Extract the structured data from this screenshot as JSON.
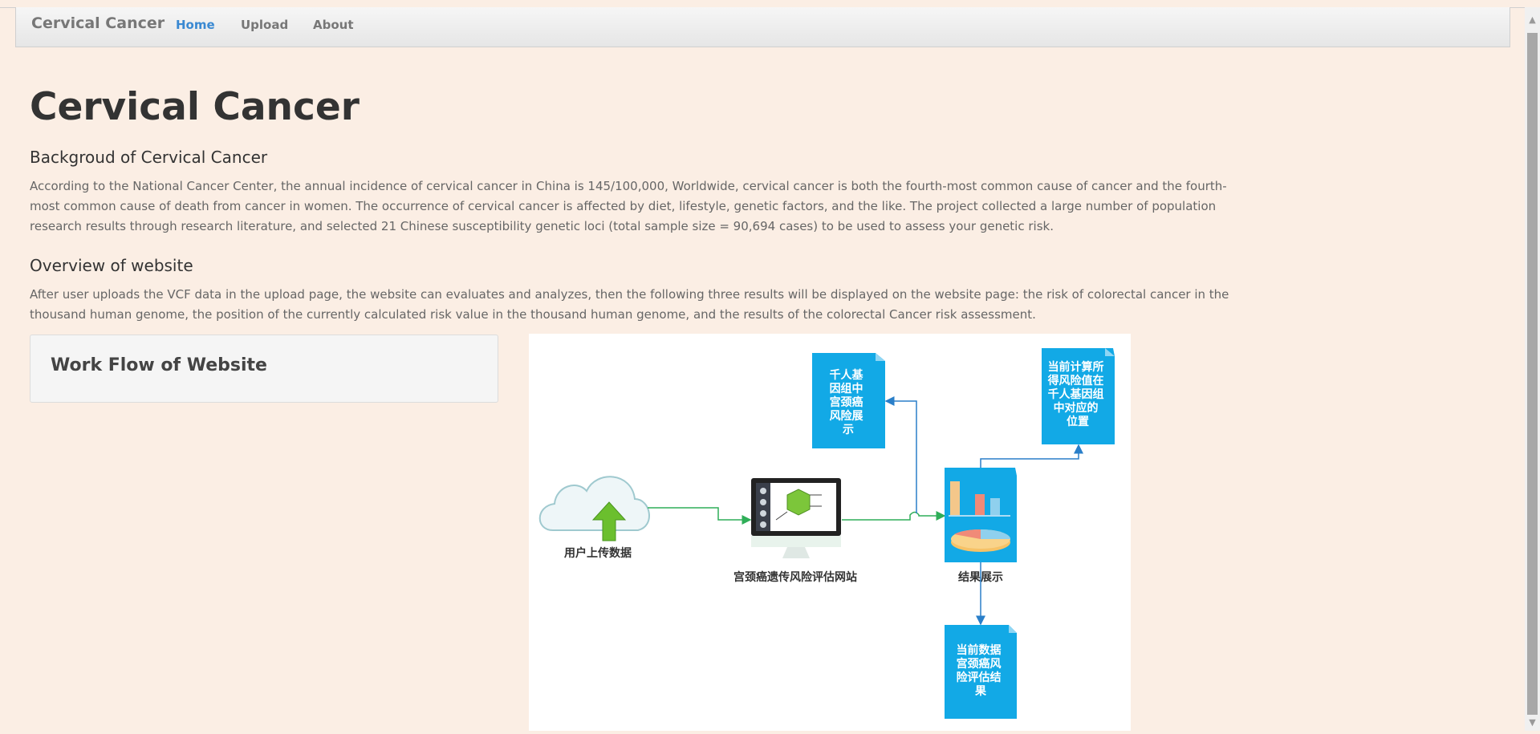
{
  "nav": {
    "brand": "Cervical Cancer",
    "links": [
      "Home",
      "Upload",
      "About"
    ]
  },
  "page": {
    "title": "Cervical Cancer",
    "background_heading": "Backgroud of Cervical Cancer",
    "background_text": "According to the National Cancer Center, the annual incidence of cervical cancer in China is 145/100,000, Worldwide, cervical cancer is both the fourth-most common cause of cancer and the fourth-most common cause of death from cancer in women. The occurrence of cervical cancer is affected by diet, lifestyle, genetic factors, and the like. The project collected a large number of population research results through research literature, and selected 21 Chinese susceptibility genetic loci (total sample size = 90,694 cases) to be used to assess your genetic risk.",
    "overview_heading": "Overview of website",
    "overview_text": "After user uploads the VCF data in the upload page, the website can evaluates and analyzes, then the following three results will be displayed on the website page: the risk of colorectal cancer in the thousand human genome, the position of the currently calculated risk value in the thousand human genome, and the results of the colorectal Cancer risk assessment.",
    "workflow_title": "Work Flow of Website"
  },
  "diagram": {
    "upload_label": "用户上传数据",
    "site_label": "宫颈癌遗传风险评估网站",
    "result_label": "结果展示",
    "doc1_lines": [
      "千人基",
      "因组中",
      "宫颈癌",
      "风险展",
      "示"
    ],
    "doc2_lines": [
      "当前计算所",
      "得风险值在",
      "千人基因组",
      "中对应的",
      "位置"
    ],
    "doc3_lines": [
      "当前数据",
      "宫颈癌风",
      "险评估结",
      "果"
    ]
  },
  "colors": {
    "page_bg": "#fbeee4",
    "active_link": "#3a89d2",
    "doc_blue": "#12a9e6",
    "green_arrow": "#2fae58",
    "blue_arrow": "#2a7fc9"
  }
}
